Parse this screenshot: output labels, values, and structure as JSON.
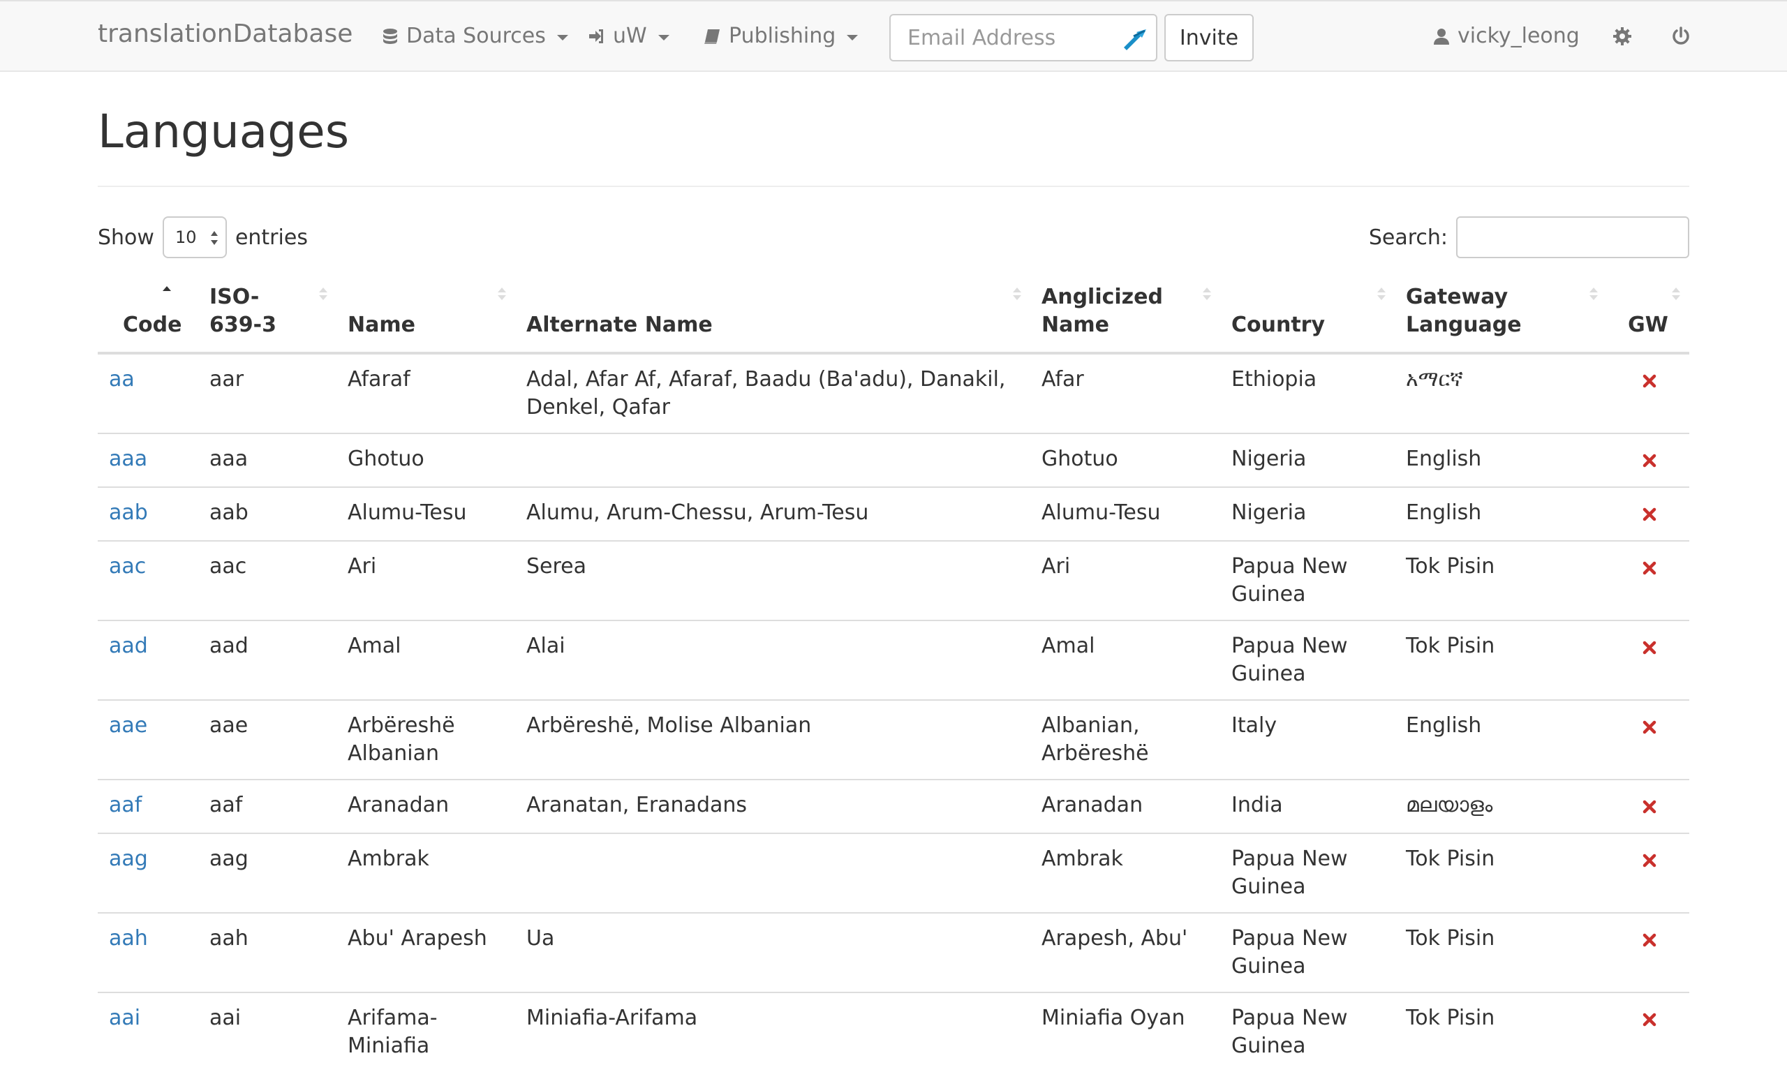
{
  "navbar": {
    "brand": "translationDatabase",
    "menus": [
      {
        "label": "Data Sources",
        "icon": "database-icon"
      },
      {
        "label": "uW",
        "icon": "sign-in-icon"
      },
      {
        "label": "Publishing",
        "icon": "book-icon"
      }
    ],
    "email_placeholder": "Email Address",
    "invite_label": "Invite",
    "username": "vicky_leong",
    "settings_icon": "gear-icon",
    "power_icon": "power-icon"
  },
  "page": {
    "title": "Languages"
  },
  "table_controls": {
    "show_label": "Show",
    "entries_label": "entries",
    "page_length": "10",
    "search_label": "Search:"
  },
  "table": {
    "columns": [
      {
        "line1": "",
        "line2": "Code"
      },
      {
        "line1": "ISO-",
        "line2": "639-3"
      },
      {
        "line1": "",
        "line2": "Name"
      },
      {
        "line1": "",
        "line2": "Alternate Name"
      },
      {
        "line1": "Anglicized",
        "line2": "Name"
      },
      {
        "line1": "",
        "line2": "Country"
      },
      {
        "line1": "Gateway",
        "line2": "Language"
      },
      {
        "line1": "",
        "line2": "GW"
      }
    ],
    "sorted_column": "Code",
    "rows": [
      {
        "code": "aa",
        "iso": "aar",
        "name": "Afaraf",
        "alt": "Adal, Afar Af, Afaraf, Baadu (Ba'adu), Danakil, Denkel, Qafar",
        "anglicized": "Afar",
        "country": "Ethiopia",
        "gateway": "አማርኛ",
        "gw": false
      },
      {
        "code": "aaa",
        "iso": "aaa",
        "name": "Ghotuo",
        "alt": "",
        "anglicized": "Ghotuo",
        "country": "Nigeria",
        "gateway": "English",
        "gw": false
      },
      {
        "code": "aab",
        "iso": "aab",
        "name": "Alumu-Tesu",
        "alt": "Alumu, Arum-Chessu, Arum-Tesu",
        "anglicized": "Alumu-Tesu",
        "country": "Nigeria",
        "gateway": "English",
        "gw": false
      },
      {
        "code": "aac",
        "iso": "aac",
        "name": "Ari",
        "alt": "Serea",
        "anglicized": "Ari",
        "country": "Papua New Guinea",
        "gateway": "Tok Pisin",
        "gw": false
      },
      {
        "code": "aad",
        "iso": "aad",
        "name": "Amal",
        "alt": "Alai",
        "anglicized": "Amal",
        "country": "Papua New Guinea",
        "gateway": "Tok Pisin",
        "gw": false
      },
      {
        "code": "aae",
        "iso": "aae",
        "name": "Arbëreshë Albanian",
        "alt": "Arbëreshë, Molise Albanian",
        "anglicized": "Albanian, Arbëreshë",
        "country": "Italy",
        "gateway": "English",
        "gw": false
      },
      {
        "code": "aaf",
        "iso": "aaf",
        "name": "Aranadan",
        "alt": "Aranatan, Eranadans",
        "anglicized": "Aranadan",
        "country": "India",
        "gateway": "മലയാളം",
        "gw": false
      },
      {
        "code": "aag",
        "iso": "aag",
        "name": "Ambrak",
        "alt": "",
        "anglicized": "Ambrak",
        "country": "Papua New Guinea",
        "gateway": "Tok Pisin",
        "gw": false
      },
      {
        "code": "aah",
        "iso": "aah",
        "name": "Abu' Arapesh",
        "alt": "Ua",
        "anglicized": "Arapesh, Abu'",
        "country": "Papua New Guinea",
        "gateway": "Tok Pisin",
        "gw": false
      },
      {
        "code": "aai",
        "iso": "aai",
        "name": "Arifama-Miniafia",
        "alt": "Miniafia-Arifama",
        "anglicized": "Miniafia Oyan",
        "country": "Papua New Guinea",
        "gateway": "Tok Pisin",
        "gw": false
      }
    ]
  },
  "colors": {
    "link": "#337ab7",
    "gw_false": "#c9302c",
    "navbar_bg": "#f8f8f8"
  }
}
